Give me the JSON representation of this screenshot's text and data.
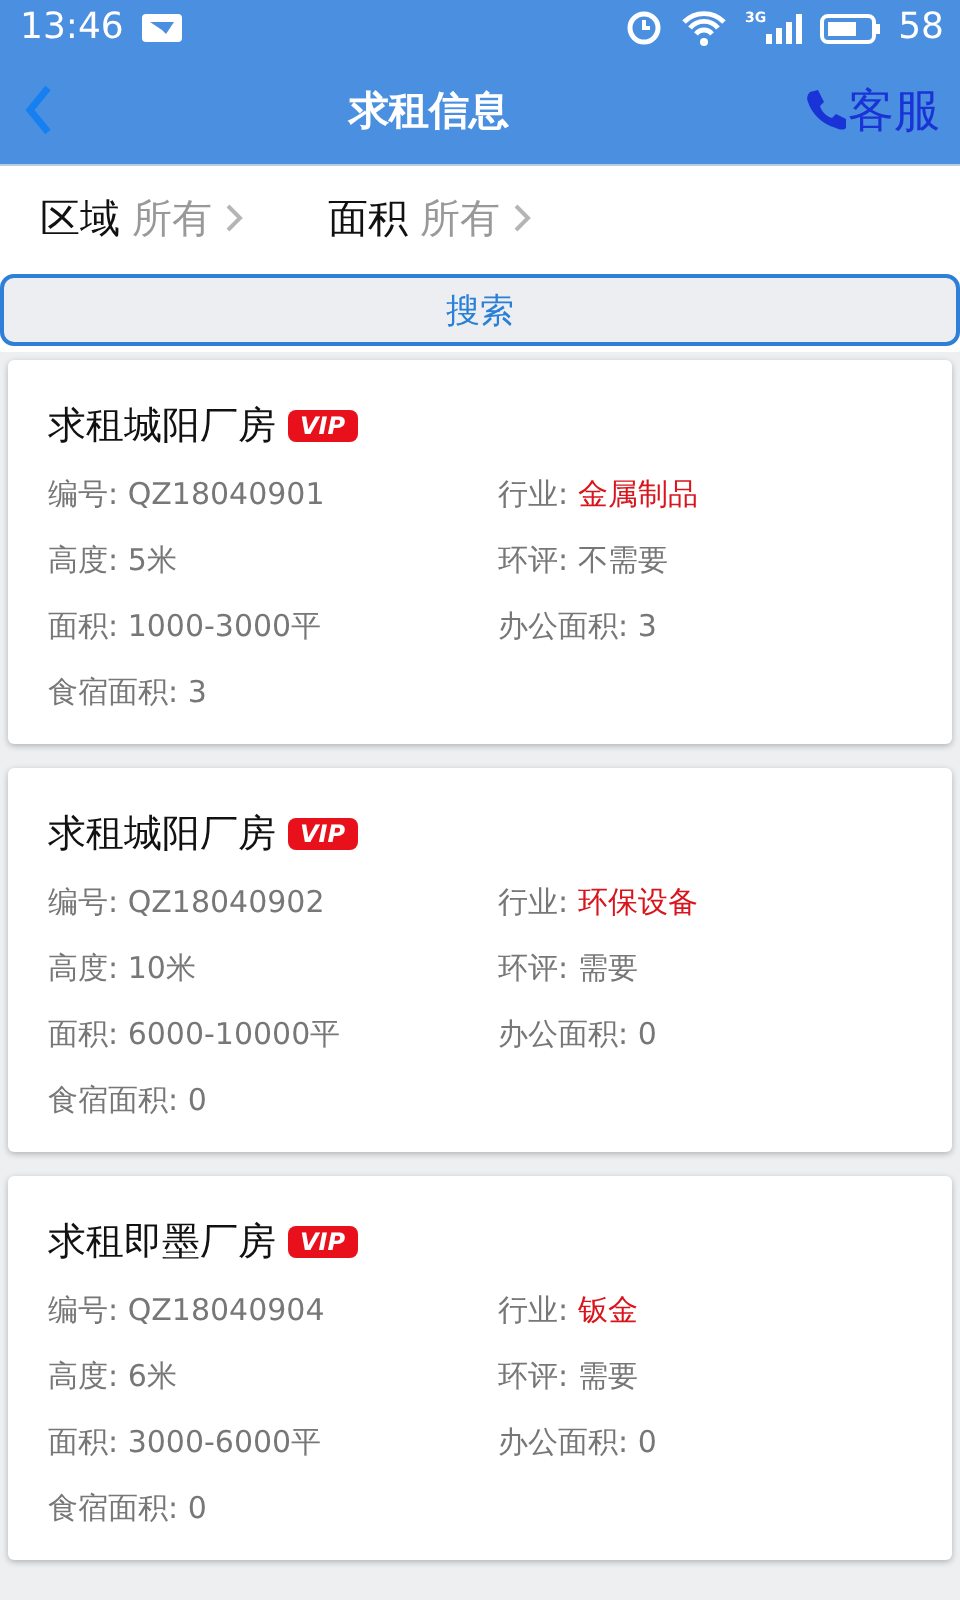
{
  "status_bar": {
    "time": "13:46",
    "network": "3G",
    "battery": "58"
  },
  "header": {
    "title": "求租信息",
    "service": "客服"
  },
  "filters": [
    {
      "label": "区域",
      "value": "所有"
    },
    {
      "label": "面积",
      "value": "所有"
    }
  ],
  "search_button": "搜索",
  "listings": [
    {
      "title": "求租城阳厂房",
      "badge": "VIP",
      "fields": [
        {
          "label": "编号:",
          "value": "QZ18040901",
          "kind": "plain"
        },
        {
          "label": "行业:",
          "value": "金属制品",
          "kind": "highlight"
        },
        {
          "label": "高度:",
          "value": "5米",
          "kind": "plain"
        },
        {
          "label": "环评:",
          "value": "不需要",
          "kind": "plain"
        },
        {
          "label": "面积:",
          "value": "1000-3000平",
          "kind": "plain"
        },
        {
          "label": "办公面积:",
          "value": "3",
          "kind": "plain"
        },
        {
          "label": "食宿面积:",
          "value": "3",
          "kind": "plain"
        }
      ]
    },
    {
      "title": "求租城阳厂房",
      "badge": "VIP",
      "fields": [
        {
          "label": "编号:",
          "value": "QZ18040902",
          "kind": "plain"
        },
        {
          "label": "行业:",
          "value": "环保设备",
          "kind": "highlight"
        },
        {
          "label": "高度:",
          "value": "10米",
          "kind": "plain"
        },
        {
          "label": "环评:",
          "value": "需要",
          "kind": "plain"
        },
        {
          "label": "面积:",
          "value": "6000-10000平",
          "kind": "plain"
        },
        {
          "label": "办公面积:",
          "value": "0",
          "kind": "plain"
        },
        {
          "label": "食宿面积:",
          "value": "0",
          "kind": "plain"
        }
      ]
    },
    {
      "title": "求租即墨厂房",
      "badge": "VIP",
      "fields": [
        {
          "label": "编号:",
          "value": "QZ18040904",
          "kind": "plain"
        },
        {
          "label": "行业:",
          "value": "钣金",
          "kind": "highlight"
        },
        {
          "label": "高度:",
          "value": "6米",
          "kind": "plain"
        },
        {
          "label": "环评:",
          "value": "需要",
          "kind": "plain"
        },
        {
          "label": "面积:",
          "value": "3000-6000平",
          "kind": "plain"
        },
        {
          "label": "办公面积:",
          "value": "0",
          "kind": "plain"
        },
        {
          "label": "食宿面积:",
          "value": "0",
          "kind": "plain"
        }
      ]
    }
  ]
}
